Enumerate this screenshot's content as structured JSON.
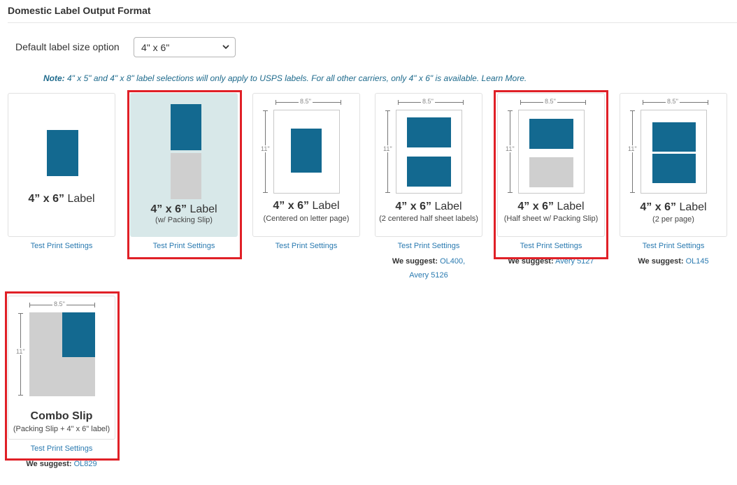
{
  "section": {
    "title": "Domestic Label Output Format"
  },
  "size_option": {
    "label": "Default label size option",
    "value": "4\" x 6\""
  },
  "note": {
    "prefix": "Note:",
    "text": " 4\" x 5\" and 4\" x 8\" label selections will only apply to USPS labels. For all other carriers, only 4\" x 6\" is available. ",
    "link": "Learn More."
  },
  "dimensions": {
    "width": "8.5''",
    "height": "11''"
  },
  "test_print": "Test Print Settings",
  "suggest_label": "We suggest:",
  "cards": [
    {
      "title_bold": "4” x 6”",
      "title_rest": " Label",
      "subtitle": ""
    },
    {
      "title_bold": "4” x 6”",
      "title_rest": " Label",
      "subtitle": "(w/ Packing Slip)"
    },
    {
      "title_bold": "4” x 6”",
      "title_rest": " Label",
      "subtitle": "(Centered on letter page)"
    },
    {
      "title_bold": "4” x 6”",
      "title_rest": " Label",
      "subtitle": "(2 centered half sheet labels)",
      "suggest_links": [
        "OL400,",
        "Avery 5126"
      ]
    },
    {
      "title_bold": "4” x 6”",
      "title_rest": " Label",
      "subtitle": "(Half sheet w/ Packing Slip)",
      "suggest_links": [
        "Avery 5127"
      ]
    },
    {
      "title_bold": "4” x 6”",
      "title_rest": " Label",
      "subtitle": "(2 per page)",
      "suggest_links": [
        "OL145"
      ]
    },
    {
      "title_bold": "Combo Slip",
      "title_rest": "",
      "subtitle": "(Packing Slip + 4\" x 6\" label)",
      "suggest_links": [
        "OL829"
      ]
    }
  ],
  "colors": {
    "label_blue": "#136990",
    "highlight_red": "#e02027",
    "selected_bg": "#d8e8e9",
    "link": "#2a7ab0"
  }
}
